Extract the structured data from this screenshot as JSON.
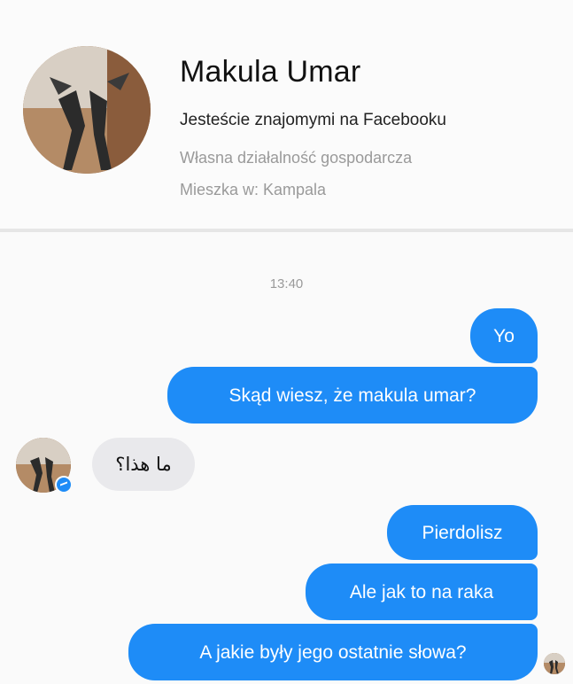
{
  "contact": {
    "name": "Makula Umar",
    "friends_text": "Jesteście znajomymi na Facebooku",
    "work": "Własna działalność gospodarcza",
    "location": "Mieszka w: Kampala"
  },
  "chat": {
    "timestamp": "13:40",
    "messages": [
      {
        "direction": "outgoing",
        "text": "Yo"
      },
      {
        "direction": "outgoing",
        "text": "Skąd wiesz, że makula umar?"
      },
      {
        "direction": "incoming",
        "text": "ما هذا؟"
      },
      {
        "direction": "outgoing",
        "text": "Pierdolisz"
      },
      {
        "direction": "outgoing",
        "text": "Ale jak to na raka"
      },
      {
        "direction": "outgoing",
        "text": "A jakie były jego ostatnie słowa?"
      }
    ]
  },
  "colors": {
    "outgoing_bubble": "#1e8cf7",
    "incoming_bubble": "#e9e9ec",
    "background": "#fafafa"
  },
  "icons": {
    "profile_photo": "profile-photo",
    "messenger_badge": "messenger-badge-icon",
    "seen_avatar": "seen-avatar"
  }
}
